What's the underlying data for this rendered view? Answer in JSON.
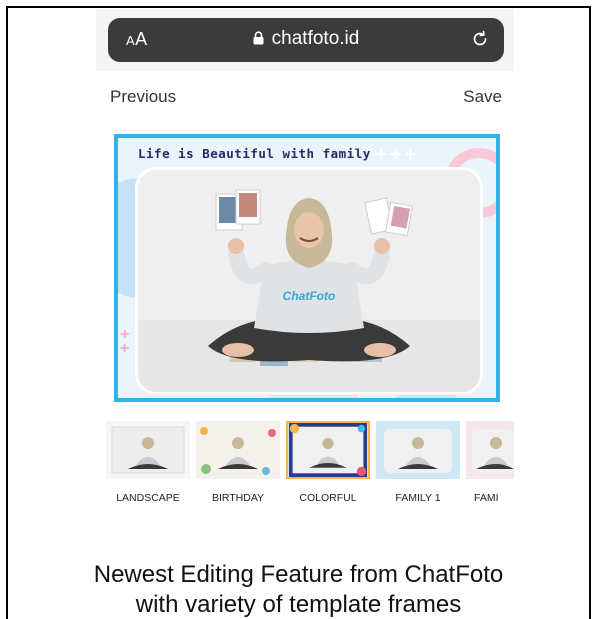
{
  "browser": {
    "aa_label": "AA",
    "domain": "chatfoto.id"
  },
  "nav": {
    "previous_label": "Previous",
    "save_label": "Save"
  },
  "template": {
    "title": "Life is Beautiful with family",
    "frame_color": "#2fb3e8",
    "shirt_text": "ChatFoto"
  },
  "thumbnails": [
    {
      "label": "LANDSCAPE"
    },
    {
      "label": "BIRTHDAY"
    },
    {
      "label": "COLORFUL"
    },
    {
      "label": "FAMILY 1"
    },
    {
      "label": "FAMI"
    }
  ],
  "caption": {
    "line1": "Newest Editing Feature from ChatFoto",
    "line2": "with variety of template frames"
  }
}
